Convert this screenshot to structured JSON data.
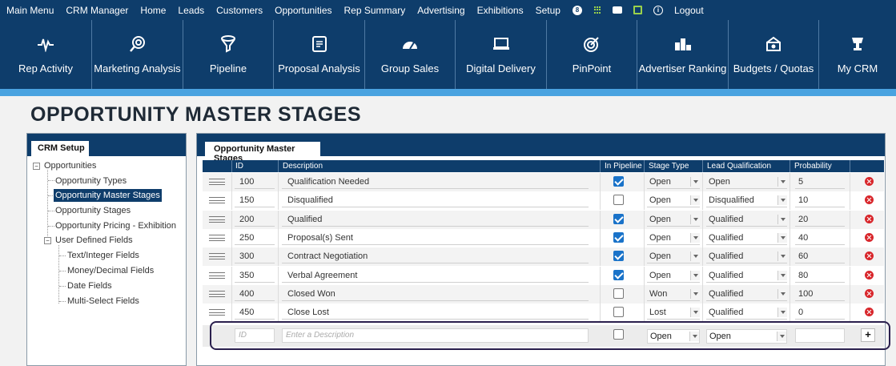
{
  "top_menu": {
    "items": [
      "Main Menu",
      "CRM Manager",
      "Home",
      "Leads",
      "Customers",
      "Opportunities",
      "Rep Summary",
      "Advertising",
      "Exhibitions",
      "Setup"
    ],
    "badge_count": "8",
    "icons": [
      "notification-badge-icon",
      "apps-grid-icon",
      "chat-icon",
      "calendar-icon",
      "info-icon"
    ],
    "logout": "Logout"
  },
  "nav_tiles": [
    {
      "label": "Rep Activity",
      "icon": "pulse-icon"
    },
    {
      "label": "Marketing Analysis",
      "icon": "target-search-icon"
    },
    {
      "label": "Pipeline",
      "icon": "funnel-icon"
    },
    {
      "label": "Proposal Analysis",
      "icon": "document-icon"
    },
    {
      "label": "Group Sales",
      "icon": "gauge-icon"
    },
    {
      "label": "Digital Delivery",
      "icon": "monitor-icon"
    },
    {
      "label": "PinPoint",
      "icon": "bullseye-icon"
    },
    {
      "label": "Advertiser Ranking",
      "icon": "podium-icon"
    },
    {
      "label": "Budgets / Quotas",
      "icon": "money-icon"
    },
    {
      "label": "My CRM",
      "icon": "person-trophy-icon"
    }
  ],
  "page_title": "OPPORTUNITY MASTER STAGES",
  "left_panel": {
    "tab": "CRM Setup",
    "tree": {
      "opportunities": "Opportunities",
      "opportunity_types": "Opportunity Types",
      "opportunity_master_stages": "Opportunity Master Stages",
      "opportunity_stages": "Opportunity Stages",
      "opportunity_pricing": "Opportunity Pricing - Exhibition",
      "user_defined_fields": "User Defined Fields",
      "text_integer": "Text/Integer Fields",
      "money_decimal": "Money/Decimal Fields",
      "date_fields": "Date Fields",
      "multi_select": "Multi-Select Fields"
    }
  },
  "main_panel": {
    "tab": "Opportunity Master Stages",
    "columns": {
      "id": "ID",
      "description": "Description",
      "in_pipeline": "In Pipeline",
      "stage_type": "Stage Type",
      "lead_qualification": "Lead Qualification",
      "probability": "Probability"
    },
    "rows": [
      {
        "id": "100",
        "description": "Qualification Needed",
        "in_pipeline": true,
        "stage_type": "Open",
        "lead_qualification": "Open",
        "probability": "5"
      },
      {
        "id": "150",
        "description": "Disqualified",
        "in_pipeline": false,
        "stage_type": "Open",
        "lead_qualification": "Disqualified",
        "probability": "10"
      },
      {
        "id": "200",
        "description": "Qualified",
        "in_pipeline": true,
        "stage_type": "Open",
        "lead_qualification": "Qualified",
        "probability": "20"
      },
      {
        "id": "250",
        "description": "Proposal(s) Sent",
        "in_pipeline": true,
        "stage_type": "Open",
        "lead_qualification": "Qualified",
        "probability": "40"
      },
      {
        "id": "300",
        "description": "Contract Negotiation",
        "in_pipeline": true,
        "stage_type": "Open",
        "lead_qualification": "Qualified",
        "probability": "60"
      },
      {
        "id": "350",
        "description": "Verbal Agreement",
        "in_pipeline": true,
        "stage_type": "Open",
        "lead_qualification": "Qualified",
        "probability": "80"
      },
      {
        "id": "400",
        "description": "Closed Won",
        "in_pipeline": false,
        "stage_type": "Won",
        "lead_qualification": "Qualified",
        "probability": "100"
      },
      {
        "id": "450",
        "description": "Close Lost",
        "in_pipeline": false,
        "stage_type": "Lost",
        "lead_qualification": "Qualified",
        "probability": "0"
      }
    ],
    "new_row": {
      "id_placeholder": "ID",
      "description_placeholder": "Enter a Description",
      "in_pipeline": false,
      "stage_type": "Open",
      "lead_qualification": "Open",
      "add_label": "+"
    }
  },
  "colors": {
    "navy": "#0e3d6b",
    "accent_stripe": "#4aa3e0",
    "checkbox_on": "#1a73c9",
    "delete_red": "#d8262b",
    "highlight_border": "#2a1f4d"
  }
}
